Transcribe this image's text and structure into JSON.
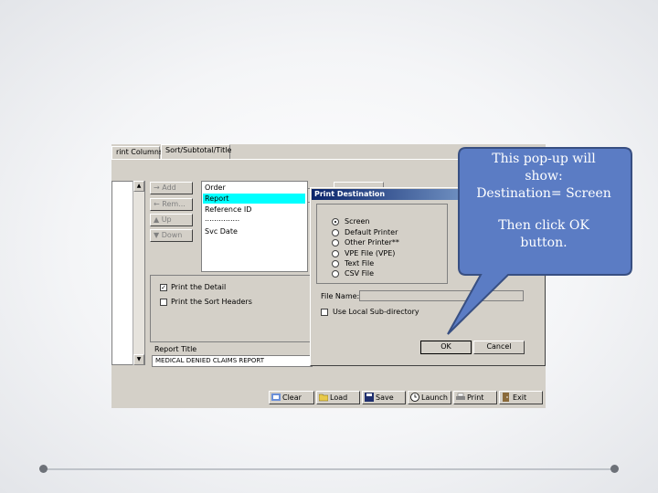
{
  "tabs": [
    "rint Columns",
    "Sort/Subtotal/Title"
  ],
  "move_buttons": [
    "Add",
    "Rem...",
    "Up",
    "Down"
  ],
  "order_header": "Order",
  "order_items": [
    "Report",
    "Reference ID",
    "...............",
    "Svc Date"
  ],
  "checkboxes": [
    {
      "label": "Print the Detail",
      "checked": true
    },
    {
      "label": "Print the Sort Headers",
      "checked": false
    }
  ],
  "report_title_label": "Report Title",
  "report_title_value": "MEDICAL DENIED CLAIMS REPORT",
  "dialog": {
    "title": "Print Destination",
    "options": [
      {
        "label": "Screen",
        "selected": true
      },
      {
        "label": "Default Printer",
        "selected": false
      },
      {
        "label": "Other Printer**",
        "selected": false
      },
      {
        "label": "VPE File (VPE)",
        "selected": false
      },
      {
        "label": "Text File",
        "selected": false
      },
      {
        "label": "CSV File",
        "selected": false
      }
    ],
    "file_name_label": "File Name:",
    "use_local_label": "Use Local Sub-directory",
    "ok_label": "OK",
    "cancel_label": "Cancel"
  },
  "toolbar": [
    "Clear",
    "Load",
    "Save",
    "Launch",
    "Print",
    "Exit"
  ],
  "callout": {
    "line1": "This pop-up will",
    "line2": "show:",
    "line3": "Destination= Screen",
    "line4": "Then click OK",
    "line5": "button.",
    "fill": "#5b7cc4",
    "stroke": "#384f82"
  }
}
